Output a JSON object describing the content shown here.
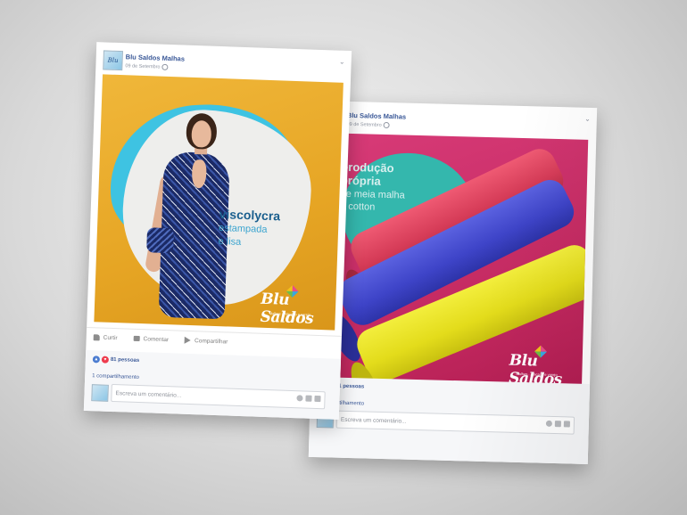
{
  "page": {
    "name": "Blu Saldos Malhas",
    "date": "09 de Setembro",
    "avatar_mark": "Blu"
  },
  "actions": {
    "like": "Curtir",
    "comment": "Comentar",
    "share": "Compartilhar"
  },
  "stats": {
    "reactions": "81 pessoas",
    "shares": "1 compartilhamento"
  },
  "comment": {
    "placeholder": "Escreva um comentário..."
  },
  "post1": {
    "headline": "viscolycra",
    "line2": "estampada",
    "line3": "e lisa"
  },
  "post2": {
    "headline1": "produção",
    "headline2": "própria",
    "line3": "de meia malha",
    "line4": "e cotton"
  },
  "logo": {
    "main": "Blu Saldos",
    "tagline": "Malhas · Atacado e varejo"
  },
  "colors": {
    "fb_blue": "#3b5998",
    "post1_bg": "#e6a524",
    "post2_bg": "#c2285f",
    "accent_cyan": "#3ec3e2",
    "accent_teal": "#34b7ad"
  }
}
